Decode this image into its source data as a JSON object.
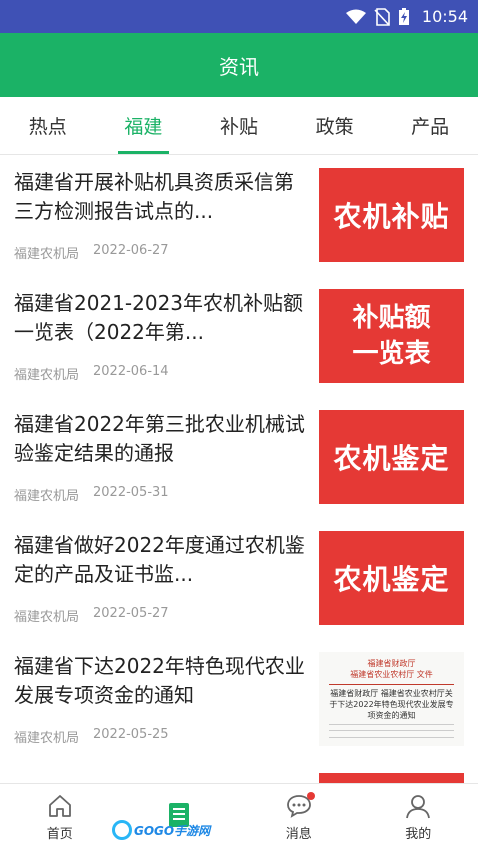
{
  "status_bar": {
    "time": "10:54"
  },
  "header": {
    "title": "资讯"
  },
  "tabs": [
    {
      "label": "热点",
      "active": false
    },
    {
      "label": "福建",
      "active": true
    },
    {
      "label": "补贴",
      "active": false
    },
    {
      "label": "政策",
      "active": false
    },
    {
      "label": "产品",
      "active": false
    }
  ],
  "news": [
    {
      "title": "福建省开展补贴机具资质采信第三方检测报告试点的...",
      "source": "福建农机局",
      "date": "2022-06-27",
      "thumb": "农机补贴"
    },
    {
      "title": "福建省2021-2023年农机补贴额一览表（2022年第...",
      "source": "福建农机局",
      "date": "2022-06-14",
      "thumb_line1": "补贴额",
      "thumb_line2": "一览表"
    },
    {
      "title": "福建省2022年第三批农业机械试验鉴定结果的通报",
      "source": "福建农机局",
      "date": "2022-05-31",
      "thumb": "农机鉴定"
    },
    {
      "title": "福建省做好2022年度通过农机鉴定的产品及证书监...",
      "source": "福建农机局",
      "date": "2022-05-27",
      "thumb": "农机鉴定"
    },
    {
      "title": "福建省下达2022年特色现代农业发展专项资金的通知",
      "source": "福建农机局",
      "date": "2022-05-25",
      "thumb_doc_header": "福建省财政厅\n福建省农业农村厅 文件",
      "thumb_doc_title": "福建省财政厅 福建省农业农村厅关于下达2022年特色现代农业发展专项资金的通知"
    }
  ],
  "bottom_nav": [
    {
      "label": "首页",
      "icon": "home-icon",
      "active": false
    },
    {
      "label": "",
      "icon": "news-icon",
      "active": true
    },
    {
      "label": "消息",
      "icon": "message-icon",
      "active": false,
      "badge": true
    },
    {
      "label": "我的",
      "icon": "profile-icon",
      "active": false
    }
  ],
  "watermark": {
    "text": "GOGO手游网"
  },
  "colors": {
    "status_bar": "#3f51b5",
    "accent": "#1bb266",
    "thumb_red": "#e53935"
  }
}
